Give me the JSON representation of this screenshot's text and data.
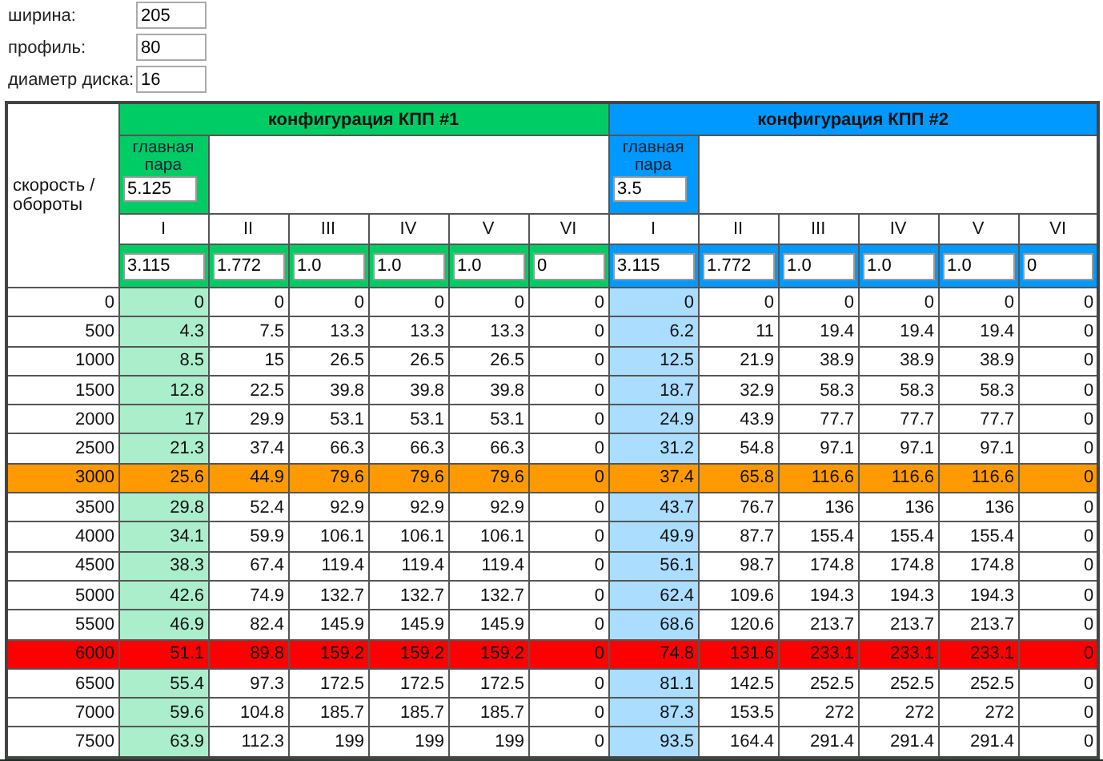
{
  "fields": [
    {
      "label": "ширина:",
      "value": "205"
    },
    {
      "label": "профиль:",
      "value": "80"
    },
    {
      "label": "диаметр диска:",
      "value": "16"
    }
  ],
  "table": {
    "speed_header": "скорость / обороты",
    "configs": [
      {
        "title": "конфигурация КПП #1",
        "color": "#00cc66",
        "main_pair_label": "главная пара",
        "main_pair": "5.125",
        "gears": [
          "I",
          "II",
          "III",
          "IV",
          "V",
          "VI"
        ],
        "ratios": [
          "3.115",
          "1.772",
          "1.0",
          "1.0",
          "1.0",
          "0"
        ]
      },
      {
        "title": "конфигурация КПП #2",
        "color": "#0099ff",
        "main_pair_label": "главная пара",
        "main_pair": "3.5",
        "gears": [
          "I",
          "II",
          "III",
          "IV",
          "V",
          "VI"
        ],
        "ratios": [
          "3.115",
          "1.772",
          "1.0",
          "1.0",
          "1.0",
          "0"
        ]
      }
    ],
    "rows": [
      {
        "rpm": "0",
        "kind": "normal",
        "values": [
          [
            "0",
            "0",
            "0",
            "0",
            "0",
            "0"
          ],
          [
            "0",
            "0",
            "0",
            "0",
            "0",
            "0"
          ]
        ]
      },
      {
        "rpm": "500",
        "kind": "normal",
        "values": [
          [
            "4.3",
            "7.5",
            "13.3",
            "13.3",
            "13.3",
            "0"
          ],
          [
            "6.2",
            "11",
            "19.4",
            "19.4",
            "19.4",
            "0"
          ]
        ]
      },
      {
        "rpm": "1000",
        "kind": "normal",
        "values": [
          [
            "8.5",
            "15",
            "26.5",
            "26.5",
            "26.5",
            "0"
          ],
          [
            "12.5",
            "21.9",
            "38.9",
            "38.9",
            "38.9",
            "0"
          ]
        ]
      },
      {
        "rpm": "1500",
        "kind": "normal",
        "values": [
          [
            "12.8",
            "22.5",
            "39.8",
            "39.8",
            "39.8",
            "0"
          ],
          [
            "18.7",
            "32.9",
            "58.3",
            "58.3",
            "58.3",
            "0"
          ]
        ]
      },
      {
        "rpm": "2000",
        "kind": "normal",
        "values": [
          [
            "17",
            "29.9",
            "53.1",
            "53.1",
            "53.1",
            "0"
          ],
          [
            "24.9",
            "43.9",
            "77.7",
            "77.7",
            "77.7",
            "0"
          ]
        ]
      },
      {
        "rpm": "2500",
        "kind": "normal",
        "values": [
          [
            "21.3",
            "37.4",
            "66.3",
            "66.3",
            "66.3",
            "0"
          ],
          [
            "31.2",
            "54.8",
            "97.1",
            "97.1",
            "97.1",
            "0"
          ]
        ]
      },
      {
        "rpm": "3000",
        "kind": "warn",
        "values": [
          [
            "25.6",
            "44.9",
            "79.6",
            "79.6",
            "79.6",
            "0"
          ],
          [
            "37.4",
            "65.8",
            "116.6",
            "116.6",
            "116.6",
            "0"
          ]
        ]
      },
      {
        "rpm": "3500",
        "kind": "normal",
        "values": [
          [
            "29.8",
            "52.4",
            "92.9",
            "92.9",
            "92.9",
            "0"
          ],
          [
            "43.7",
            "76.7",
            "136",
            "136",
            "136",
            "0"
          ]
        ]
      },
      {
        "rpm": "4000",
        "kind": "normal",
        "values": [
          [
            "34.1",
            "59.9",
            "106.1",
            "106.1",
            "106.1",
            "0"
          ],
          [
            "49.9",
            "87.7",
            "155.4",
            "155.4",
            "155.4",
            "0"
          ]
        ]
      },
      {
        "rpm": "4500",
        "kind": "normal",
        "values": [
          [
            "38.3",
            "67.4",
            "119.4",
            "119.4",
            "119.4",
            "0"
          ],
          [
            "56.1",
            "98.7",
            "174.8",
            "174.8",
            "174.8",
            "0"
          ]
        ]
      },
      {
        "rpm": "5000",
        "kind": "normal",
        "values": [
          [
            "42.6",
            "74.9",
            "132.7",
            "132.7",
            "132.7",
            "0"
          ],
          [
            "62.4",
            "109.6",
            "194.3",
            "194.3",
            "194.3",
            "0"
          ]
        ]
      },
      {
        "rpm": "5500",
        "kind": "normal",
        "values": [
          [
            "46.9",
            "82.4",
            "145.9",
            "145.9",
            "145.9",
            "0"
          ],
          [
            "68.6",
            "120.6",
            "213.7",
            "213.7",
            "213.7",
            "0"
          ]
        ]
      },
      {
        "rpm": "6000",
        "kind": "limit",
        "values": [
          [
            "51.1",
            "89.8",
            "159.2",
            "159.2",
            "159.2",
            "0"
          ],
          [
            "74.8",
            "131.6",
            "233.1",
            "233.1",
            "233.1",
            "0"
          ]
        ]
      },
      {
        "rpm": "6500",
        "kind": "normal",
        "values": [
          [
            "55.4",
            "97.3",
            "172.5",
            "172.5",
            "172.5",
            "0"
          ],
          [
            "81.1",
            "142.5",
            "252.5",
            "252.5",
            "252.5",
            "0"
          ]
        ]
      },
      {
        "rpm": "7000",
        "kind": "normal",
        "values": [
          [
            "59.6",
            "104.8",
            "185.7",
            "185.7",
            "185.7",
            "0"
          ],
          [
            "87.3",
            "153.5",
            "272",
            "272",
            "272",
            "0"
          ]
        ]
      },
      {
        "rpm": "7500",
        "kind": "normal",
        "values": [
          [
            "63.9",
            "112.3",
            "199",
            "199",
            "199",
            "0"
          ],
          [
            "93.5",
            "164.4",
            "291.4",
            "291.4",
            "291.4",
            "0"
          ]
        ]
      }
    ]
  }
}
